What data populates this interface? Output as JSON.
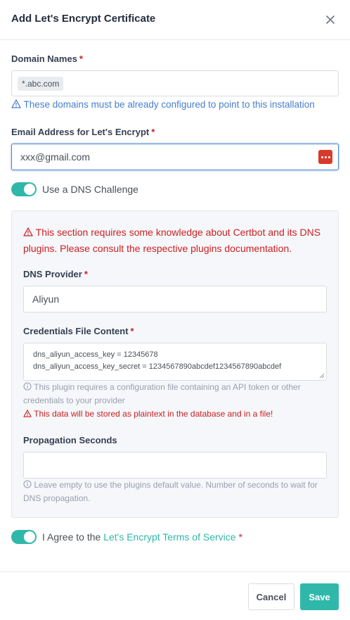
{
  "modal": {
    "title": "Add Let's Encrypt Certificate"
  },
  "domains": {
    "label": "Domain Names",
    "required_mark": "*",
    "tags": [
      "*.abc.com"
    ],
    "help": "These domains must be already configured to point to this installation"
  },
  "email": {
    "label": "Email Address for Let's Encrypt",
    "required_mark": "*",
    "value": "xxx@gmail.com"
  },
  "dns_challenge": {
    "enabled": true,
    "label": "Use a DNS Challenge"
  },
  "dns_panel": {
    "warning": "This section requires some knowledge about Certbot and its DNS plugins. Please consult the respective plugins documentation.",
    "provider": {
      "label": "DNS Provider",
      "required_mark": "*",
      "value": "Aliyun"
    },
    "credentials": {
      "label": "Credentials File Content",
      "required_mark": "*",
      "value_line1": "dns_aliyun_access_key = 12345678",
      "value_line2": "dns_aliyun_access_key_secret = 1234567890abcdef1234567890abcdef",
      "info": "This plugin requires a configuration file containing an API token or other credentials to your provider",
      "warning": "This data will be stored as plaintext in the database and in a file!"
    },
    "propagation": {
      "label": "Propagation Seconds",
      "value": "",
      "info": "Leave empty to use the plugins default value. Number of seconds to wait for DNS propagation."
    }
  },
  "agree": {
    "enabled": true,
    "prefix": "I Agree to the",
    "link": "Let's Encrypt Terms of Service",
    "required_mark": "*"
  },
  "footer": {
    "cancel_label": "Cancel",
    "save_label": "Save"
  },
  "colors": {
    "accent": "#2fb8a9",
    "danger": "#cd201f",
    "info": "#467fcf"
  }
}
